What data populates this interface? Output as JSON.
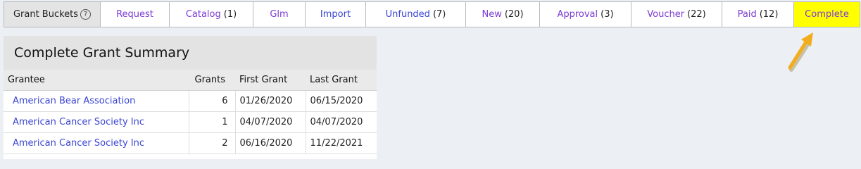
{
  "buckets": {
    "label": "Grant Buckets",
    "help": "?",
    "tabs": [
      {
        "name": "Request",
        "count": ""
      },
      {
        "name": "Catalog",
        "count": "(1)"
      },
      {
        "name": "Glm",
        "count": ""
      },
      {
        "name": "Import",
        "count": ""
      },
      {
        "name": "Unfunded",
        "count": "(7)"
      },
      {
        "name": "New",
        "count": "(20)"
      },
      {
        "name": "Approval",
        "count": "(3)"
      },
      {
        "name": "Voucher",
        "count": "(22)"
      },
      {
        "name": "Paid",
        "count": "(12)"
      },
      {
        "name": "Complete",
        "count": ""
      }
    ],
    "active_tab": "Complete"
  },
  "colors": {
    "active_tab_bg": "#ffff00",
    "arrow": "#f2ad1c",
    "link": "#3a45d4"
  },
  "summary": {
    "title": "Complete Grant Summary",
    "columns": [
      "Grantee",
      "Grants",
      "First Grant",
      "Last Grant"
    ],
    "rows": [
      {
        "grantee": "American Bear Association",
        "grants": "6",
        "first": "01/26/2020",
        "last": "06/15/2020"
      },
      {
        "grantee": "American Cancer Society Inc",
        "grants": "1",
        "first": "04/07/2020",
        "last": "04/07/2020"
      },
      {
        "grantee": "American Cancer Society Inc",
        "grants": "2",
        "first": "06/16/2020",
        "last": "11/22/2021"
      }
    ]
  }
}
